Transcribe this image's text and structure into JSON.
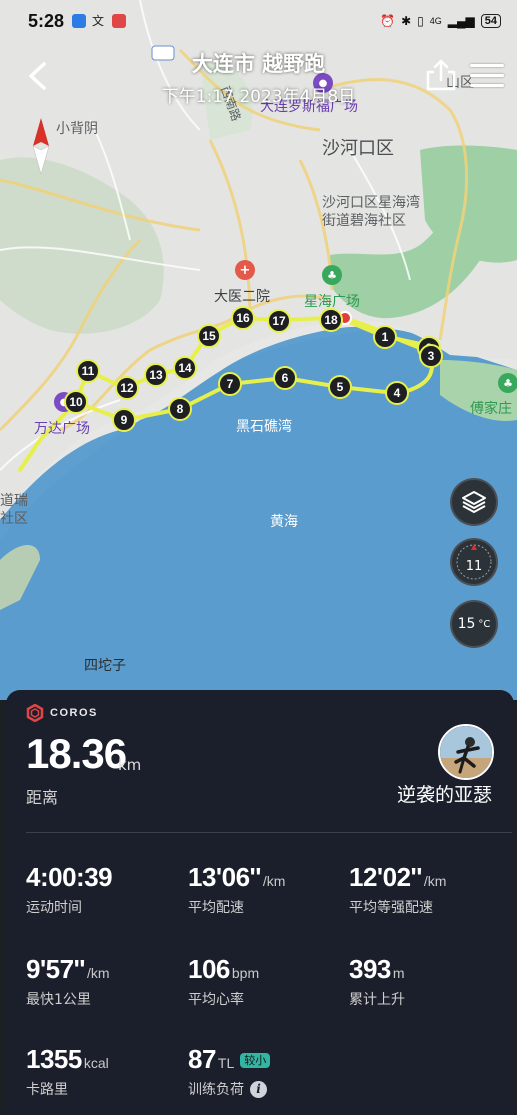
{
  "status_bar": {
    "time": "5:28",
    "signal_text": "4G",
    "battery": "54"
  },
  "header": {
    "title": "大连市 越野跑",
    "subtitle": "下午1:17  2023年4月8日",
    "back_icon": "back-arrow-icon",
    "share_icon": "share-icon",
    "menu_icon": "menu-icon"
  },
  "map": {
    "labels": {
      "xiaobeiyin": "小背阴",
      "shahekou": "沙河口区",
      "xinghaiwan": "沙河口区星海湾",
      "bihai": "街道碧海社区",
      "dayi": "大医二院",
      "xinghai_square": "星海广场",
      "russia_square": "大连罗斯福广场",
      "wanda": "万达广场",
      "heishijiao": "黑石礁湾",
      "huanghai": "黄海",
      "fujiazhuang": "傅家庄",
      "sitouzi": "四坨子",
      "daorui": "道瑞",
      "qu": "社区",
      "zhongshan_road": "西南路",
      "xigang_suffix": "山区"
    },
    "km_markers": [
      "1",
      "2",
      "3",
      "4",
      "5",
      "6",
      "7",
      "8",
      "9",
      "10",
      "11",
      "12",
      "13",
      "14",
      "15",
      "16",
      "17",
      "18"
    ],
    "route_color": "#e7f04b",
    "compass_value": "11",
    "temperature": "15",
    "temperature_unit": "°C"
  },
  "panel": {
    "brand": "COROS",
    "distance": "18.36",
    "distance_unit": "km",
    "distance_label": "距离",
    "username": "逆袭的亚瑟",
    "stats": [
      {
        "value": "4:00:39",
        "unit": "",
        "label": "运动时间"
      },
      {
        "value": "13'06''",
        "unit": "/km",
        "label": "平均配速"
      },
      {
        "value": "12'02''",
        "unit": "/km",
        "label": "平均等强配速"
      },
      {
        "value": "9'57''",
        "unit": "/km",
        "label": "最快1公里"
      },
      {
        "value": "106",
        "unit": "bpm",
        "label": "平均心率"
      },
      {
        "value": "393",
        "unit": "m",
        "label": "累计上升"
      },
      {
        "value": "1355",
        "unit": "kcal",
        "label": "卡路里"
      },
      {
        "value": "87",
        "unit": "TL",
        "label": "训练负荷",
        "badge": "较小"
      }
    ]
  }
}
